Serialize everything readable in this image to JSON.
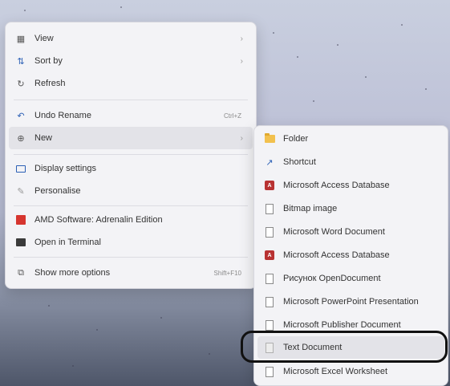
{
  "context_menu": {
    "items": [
      {
        "label": "View",
        "icon": "grid-icon",
        "chevron": "›"
      },
      {
        "label": "Sort by",
        "icon": "sort-icon",
        "chevron": "›"
      },
      {
        "label": "Refresh",
        "icon": "refresh-icon"
      },
      {
        "label": "Undo Rename",
        "icon": "undo-icon",
        "shortcut": "Ctrl+Z"
      },
      {
        "label": "New",
        "icon": "new-icon",
        "chevron": "›"
      },
      {
        "label": "Display settings",
        "icon": "display-icon"
      },
      {
        "label": "Personalise",
        "icon": "brush-icon"
      },
      {
        "label": "AMD Software: Adrenalin Edition",
        "icon": "amd-icon"
      },
      {
        "label": "Open in Terminal",
        "icon": "terminal-icon"
      },
      {
        "label": "Show more options",
        "icon": "more-options-icon",
        "shortcut": "Shift+F10"
      }
    ]
  },
  "new_submenu": {
    "items": [
      {
        "label": "Folder",
        "icon": "folder-icon"
      },
      {
        "label": "Shortcut",
        "icon": "shortcut-icon"
      },
      {
        "label": "Microsoft Access Database",
        "icon": "access-icon"
      },
      {
        "label": "Bitmap image",
        "icon": "document-icon"
      },
      {
        "label": "Microsoft Word Document",
        "icon": "document-icon"
      },
      {
        "label": "Microsoft Access Database",
        "icon": "access-icon"
      },
      {
        "label": "Рисунок OpenDocument",
        "icon": "document-icon"
      },
      {
        "label": "Microsoft PowerPoint Presentation",
        "icon": "document-icon"
      },
      {
        "label": "Microsoft Publisher Document",
        "icon": "document-icon"
      },
      {
        "label": "Text Document",
        "icon": "document-icon"
      },
      {
        "label": "Microsoft Excel Worksheet",
        "icon": "document-icon"
      }
    ]
  },
  "colors": {
    "menu_bg": "#f3f3f6",
    "hover_bg": "#e3e3e8",
    "access_red": "#b83232",
    "folder_yellow": "#f2c14e"
  }
}
